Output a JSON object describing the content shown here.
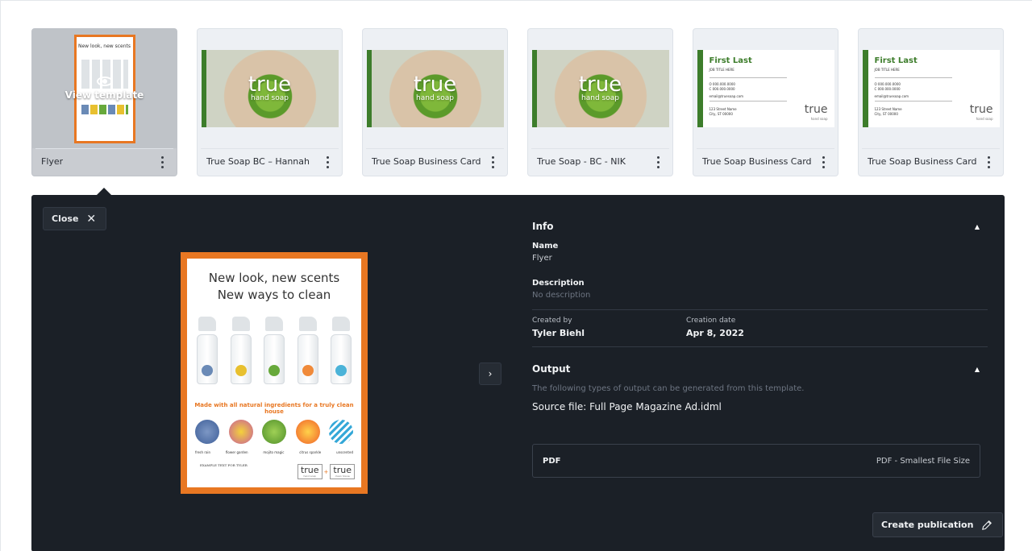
{
  "templates": [
    {
      "label": "Flyer",
      "selected": true,
      "overlay_label": "View template",
      "thumb": "flyer"
    },
    {
      "label": "True Soap BC – Hannah",
      "thumb": "soap"
    },
    {
      "label": "True Soap Business Card ...",
      "thumb": "soap"
    },
    {
      "label": "True Soap - BC - NIK",
      "thumb": "soap"
    },
    {
      "label": "True Soap Business Card ...",
      "thumb": "card"
    },
    {
      "label": "True Soap Business Card ...",
      "thumb": "card"
    }
  ],
  "thumbs": {
    "flyer_title": "New look, new scents\nNew ways to clean",
    "soap_brand": "true",
    "soap_sub": "hand soap",
    "card_name": "First Last",
    "card_job": "JOB TITLE HERE",
    "card_phone_o": "O  000.000.0000",
    "card_phone_c": "C  000.000.0000",
    "card_email": "email@truesoap.com",
    "card_addr1": "123 Street Name",
    "card_addr2": "City, ST 00000",
    "card_brand": "true",
    "card_sub": "hand soap"
  },
  "panel": {
    "close_label": "Close",
    "preview": {
      "title_line1": "New look, new scents",
      "title_line2": "New ways to clean",
      "tagline": "Made with all natural ingredients for a truly clean house",
      "captions": [
        "fresh rain",
        "flower garden",
        "mojito magic",
        "citrus sparkle",
        "unscented"
      ],
      "example_text": "EXAMPLE TEXT FOR TYLER",
      "logo1_main": "true",
      "logo1_sub": "hand soap",
      "logo2_main": "true",
      "logo2_sub": "clean house"
    },
    "info": {
      "heading": "Info",
      "name_label": "Name",
      "name_value": "Flyer",
      "description_label": "Description",
      "description_value": "No description",
      "created_by_label": "Created by",
      "created_by_value": "Tyler Biehl",
      "creation_date_label": "Creation date",
      "creation_date_value": "Apr 8, 2022"
    },
    "output": {
      "heading": "Output",
      "note": "The following types of output can be generated from this template.",
      "source_file": "Source file: Full Page Magazine Ad.idml",
      "format": "PDF",
      "preset": "PDF - Smallest File Size"
    },
    "create_label": "Create publication"
  },
  "colors": {
    "panel_bg": "#1b2027",
    "accent_orange": "#e87722",
    "brand_green": "#3d7d2b"
  }
}
